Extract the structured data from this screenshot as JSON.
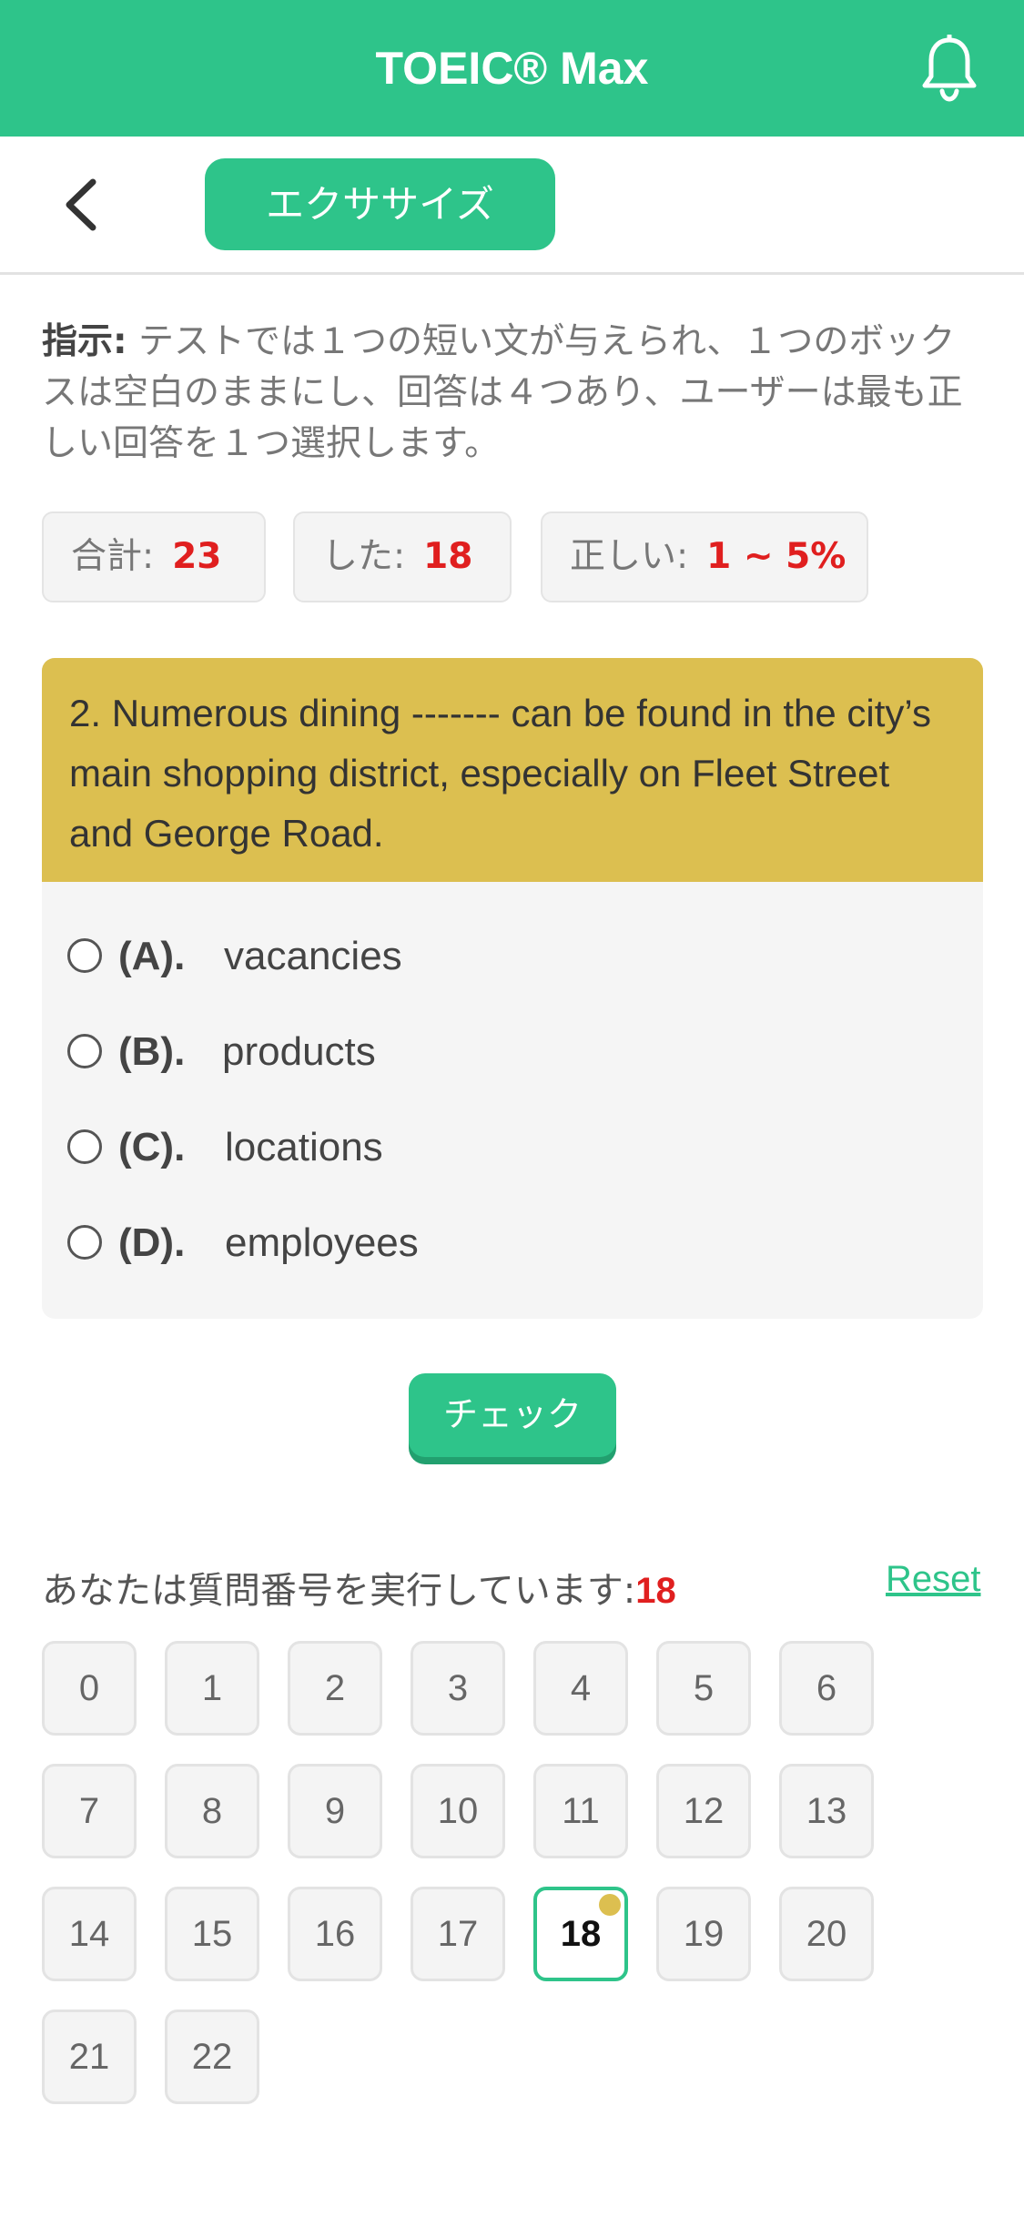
{
  "header": {
    "title": "TOEIC® Max",
    "notification_icon": "bell-icon"
  },
  "subnav": {
    "back_icon": "chevron-left-icon",
    "exercise_label": "エクササイズ"
  },
  "instruction": {
    "lead": "指示:",
    "text": " テストでは１つの短い文が与えられ、１つのボックスは空白のままにし、回答は４つあり、ユーザーは最も正しい回答を１つ選択します。"
  },
  "stats": {
    "total_label": "合計:",
    "total_value": "23",
    "done_label": "した:",
    "done_value": "18",
    "correct_label": "正しい:",
    "correct_value": "1 ~ 5%"
  },
  "question": {
    "text": "2. Numerous dining ------- can be found in the city’s main shopping district, especially on Fleet Street and George Road.",
    "options": [
      {
        "letter": "(A).",
        "text": "vacancies"
      },
      {
        "letter": "(B).",
        "text": "products"
      },
      {
        "letter": "(C).",
        "text": "locations"
      },
      {
        "letter": "(D).",
        "text": "employees"
      }
    ]
  },
  "check_label": "チェック",
  "progress": {
    "label": "あなたは質問番号を実行しています:",
    "current": "18",
    "reset_label": "Reset"
  },
  "question_numbers": [
    "0",
    "1",
    "2",
    "3",
    "4",
    "5",
    "6",
    "7",
    "8",
    "9",
    "10",
    "11",
    "12",
    "13",
    "14",
    "15",
    "16",
    "17",
    "18",
    "19",
    "20",
    "21",
    "22"
  ],
  "colors": {
    "brand_green": "#2ec48a",
    "question_header": "#dcbf50",
    "accent_red": "#e01f1f"
  }
}
